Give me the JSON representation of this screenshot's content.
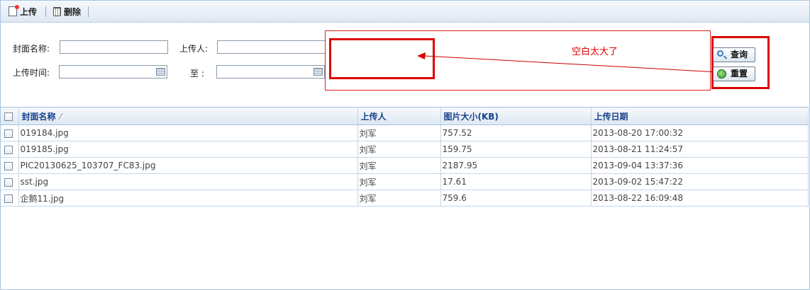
{
  "toolbar": {
    "upload_label": "上传",
    "delete_label": "删除"
  },
  "search": {
    "cover_name_label": "封面名称:",
    "uploader_label": "上传人:",
    "upload_time_label": "上传时间:",
    "to_label": "至 :",
    "cover_name_value": "",
    "uploader_value": "",
    "time_from_value": "",
    "time_to_value": "",
    "query_button": "查询",
    "reset_button": "重置"
  },
  "annotation": {
    "text": "空白太大了",
    "color": "#dd0000"
  },
  "table": {
    "columns": [
      "封面名称",
      "上传人",
      "图片大小(KB)",
      "上传日期"
    ],
    "sort_indicator": "⁄",
    "rows": [
      [
        "019184.jpg",
        "刘军",
        "757.52",
        "2013-08-20 17:00:32"
      ],
      [
        "019185.jpg",
        "刘军",
        "159.75",
        "2013-08-21 11:24:57"
      ],
      [
        "PIC20130625_103707_FC83.jpg",
        "刘军",
        "2187.95",
        "2013-09-04 13:37:36"
      ],
      [
        "sst.jpg",
        "刘军",
        "17.61",
        "2013-09-02 15:47:22"
      ],
      [
        "企鹅11.jpg",
        "刘军",
        "759.6",
        "2013-08-22 16:09:48"
      ]
    ]
  },
  "colors": {
    "header_text": "#15428b",
    "border": "#a9c4de",
    "annotation_red": "#dd0000"
  }
}
